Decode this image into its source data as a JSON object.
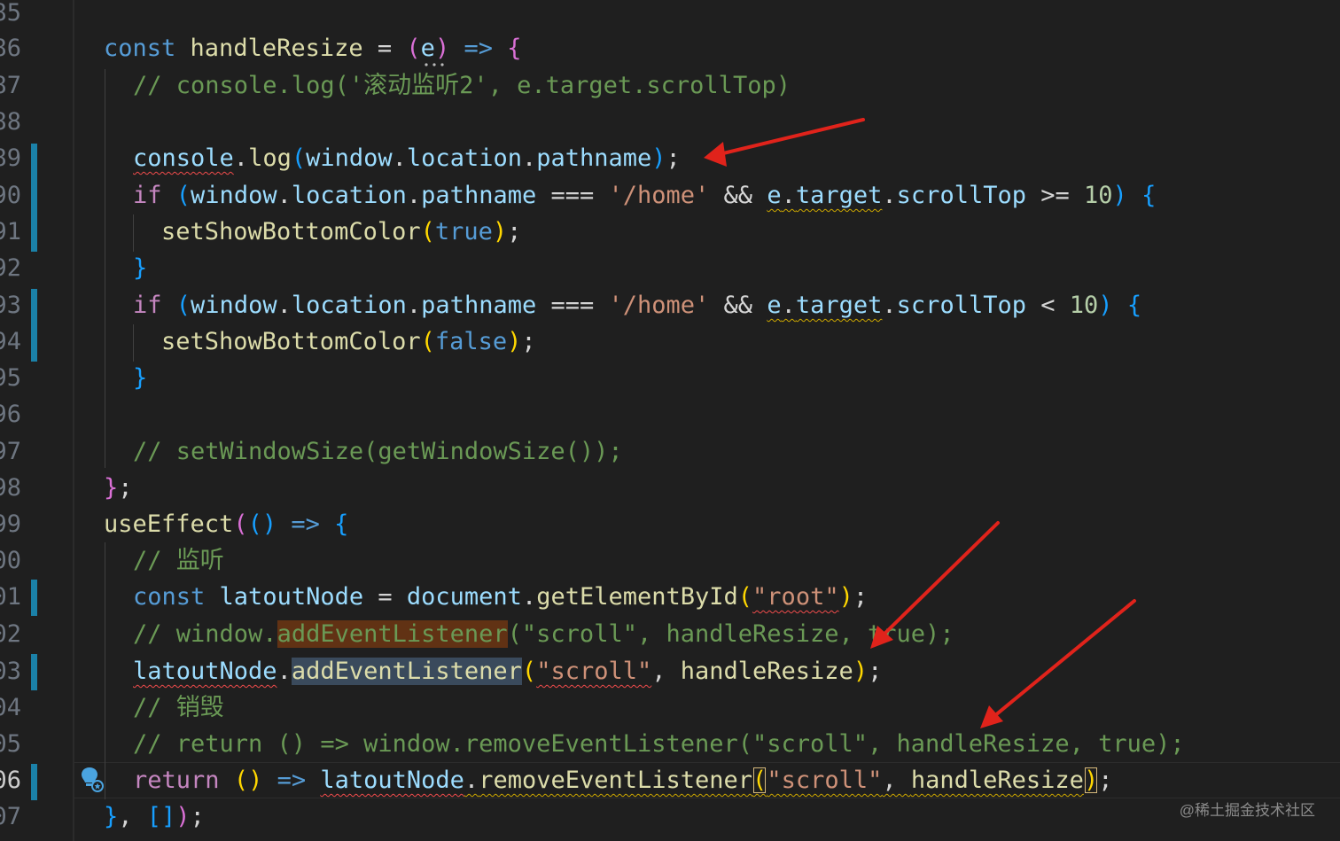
{
  "gutter": {
    "line_numbers": [
      "85",
      "86",
      "87",
      "88",
      "89",
      "90",
      "91",
      "92",
      "93",
      "94",
      "95",
      "96",
      "97",
      "98",
      "99",
      "00",
      "01",
      "02",
      "03",
      "04",
      "05",
      "06",
      "07"
    ]
  },
  "code": {
    "l86": {
      "kw": "const",
      "name": "handleResize",
      "eq": " = ",
      "p1": "(",
      "param": "e",
      "p2": ")",
      "arrow": " => ",
      "brace": "{"
    },
    "l87": {
      "comment": "// console.log('滚动监听2', e.target.scrollTop)"
    },
    "l89": {
      "obj": "console",
      "dot": ".",
      "method": "log",
      "p1": "(",
      "win": "window",
      "d1": ".",
      "loc": "location",
      "d2": ".",
      "path": "pathname",
      "p2": ")",
      "semi": ";"
    },
    "l90": {
      "kw": "if",
      "sp": " ",
      "p1": "(",
      "win": "window",
      "d1": ".",
      "loc": "location",
      "d2": ".",
      "path": "pathname",
      "op": " === ",
      "str": "'/home'",
      "and": " && ",
      "e": "e",
      "d3": ".",
      "target": "target",
      "d4": ".",
      "scroll": "scrollTop",
      "cmp": " >= ",
      "num": "10",
      "p2": ")",
      "sp2": " ",
      "brace": "{"
    },
    "l91": {
      "fn": "setShowBottomColor",
      "p1": "(",
      "val": "true",
      "p2": ")",
      "semi": ";"
    },
    "l92": {
      "brace": "}"
    },
    "l93": {
      "kw": "if",
      "sp": " ",
      "p1": "(",
      "win": "window",
      "d1": ".",
      "loc": "location",
      "d2": ".",
      "path": "pathname",
      "op": " === ",
      "str": "'/home'",
      "and": " && ",
      "e": "e",
      "d3": ".",
      "target": "target",
      "d4": ".",
      "scroll": "scrollTop",
      "cmp": " < ",
      "num": "10",
      "p2": ")",
      "sp2": " ",
      "brace": "{"
    },
    "l94": {
      "fn": "setShowBottomColor",
      "p1": "(",
      "val": "false",
      "p2": ")",
      "semi": ";"
    },
    "l95": {
      "brace": "}"
    },
    "l97": {
      "comment": "// setWindowSize(getWindowSize());"
    },
    "l98": {
      "brace": "}",
      "semi": ";"
    },
    "l99": {
      "fn": "useEffect",
      "p1": "(",
      "p2": "()",
      "arrow": " => ",
      "brace": "{"
    },
    "l100": {
      "comment": "// 监听"
    },
    "l101": {
      "kw": "const",
      "sp": " ",
      "name": "latoutNode",
      "eq": " = ",
      "doc": "document",
      "dot": ".",
      "method": "getElementById",
      "p1": "(",
      "str": "\"root\"",
      "p2": ")",
      "semi": ";"
    },
    "l102": {
      "c1": "// window.",
      "c2": "addEventListener",
      "c3": "(\"scroll\", handleResize, true);"
    },
    "l103": {
      "node": "latoutNode",
      "dot": ".",
      "method": "addEventListener",
      "p1": "(",
      "str": "\"scroll\"",
      "comma": ", ",
      "handler": "handleResize",
      "p2": ")",
      "semi": ";"
    },
    "l104": {
      "comment": "// 销毁"
    },
    "l105": {
      "comment": "// return () => window.removeEventListener(\"scroll\", handleResize, true);"
    },
    "l106": {
      "kw": "return",
      "sp": " ",
      "parens": "()",
      "arrow": " => ",
      "node": "latoutNode",
      "dot": ".",
      "method": "removeEventListener",
      "p1": "(",
      "str": "\"scroll\"",
      "comma": ", ",
      "handler": "handleResize",
      "p2": ")",
      "semi": ";"
    },
    "l107": {
      "brace": "}",
      "comma": ", ",
      "arr": "[]",
      "p": ")",
      "semi": ";"
    }
  },
  "watermark": "@稀土掘金技术社区",
  "colors": {
    "annotation_arrow": "#e0231b",
    "modified_marker": "#1b81a8"
  },
  "icons": {
    "lightbulb": "lightbulb-autofix-icon"
  }
}
